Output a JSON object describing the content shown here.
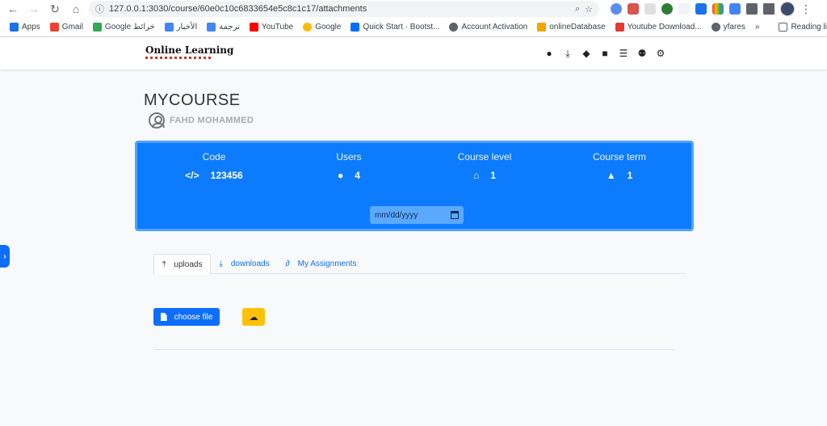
{
  "browser": {
    "url": "127.0.0.1:3030/course/60e0c10c6833654e5c8c1c17/attachments",
    "bookmarks": [
      "Apps",
      "Gmail",
      "Google خرائط",
      "الأخبار",
      "ترجمة",
      "YouTube",
      "Google",
      "Quick Start · Bootst...",
      "Account Activation",
      "onlineDatabase",
      "Youtube Download...",
      "yfares"
    ],
    "reading_list": "Reading list"
  },
  "navbar": {
    "logo_text": "Online Learning",
    "icons": [
      "user-icon",
      "download-icon",
      "comments-icon",
      "video-icon",
      "list-icon",
      "users-icon",
      "settings-icon"
    ]
  },
  "course": {
    "title": "MYCOURSE",
    "instructor": "FAHD MOHAMMED"
  },
  "info": {
    "code_label": "Code",
    "code_value": "123456",
    "users_label": "Users",
    "users_value": "4",
    "level_label": "Course level",
    "level_value": "1",
    "term_label": "Course term",
    "term_value": "1",
    "date_placeholder": "mm/dd/yyyy"
  },
  "tabs": {
    "uploads": "uploads",
    "downloads": "downloads",
    "assignments": "My Assignments"
  },
  "actions": {
    "choose_file": "choose file"
  },
  "colors": {
    "primary": "#0d6efd",
    "card": "#0d7bfd",
    "warning": "#ffc107"
  }
}
